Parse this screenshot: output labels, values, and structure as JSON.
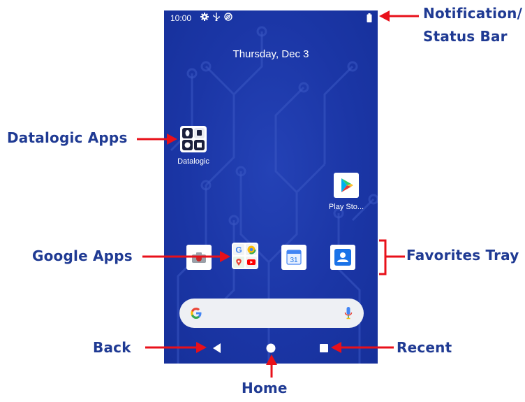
{
  "callouts": {
    "notification_line1": "Notification/",
    "notification_line2": "Status Bar",
    "datalogic_apps": "Datalogic Apps",
    "google_apps": "Google Apps",
    "favorites_tray": "Favorites Tray",
    "back": "Back",
    "recent": "Recent",
    "home": "Home"
  },
  "status_bar": {
    "time": "10:00",
    "icons": [
      "gear-icon",
      "usb-icon",
      "sync-icon"
    ],
    "right_icon": "battery-icon"
  },
  "home_screen": {
    "date": "Thursday, Dec 3",
    "apps": [
      {
        "label": "Datalogic",
        "icon": "datalogic-folder-icon"
      },
      {
        "label": "Play Sto...",
        "icon": "play-store-icon"
      }
    ],
    "favorites": [
      "camera-icon",
      "google-apps-folder-icon",
      "calendar-icon",
      "contacts-icon"
    ],
    "calendar_day": "31",
    "search_bar": {
      "left_icon": "google-g-icon",
      "right_icon": "microphone-icon"
    }
  },
  "nav_bar": [
    "back-button",
    "home-button",
    "recent-button"
  ],
  "colors": {
    "callout": "#1f3a93",
    "arrow": "#e8101a",
    "wallpaper": "#1b36a6"
  }
}
